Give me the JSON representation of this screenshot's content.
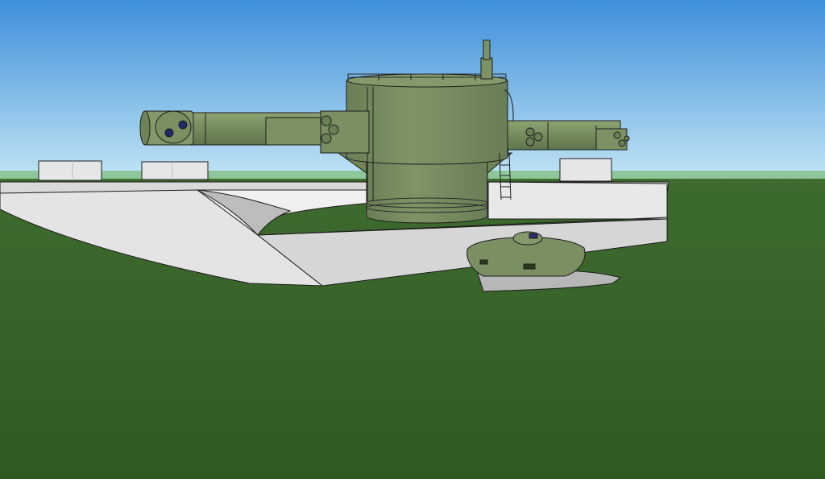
{
  "scene": {
    "kind": "3d-model-viewport",
    "colors": {
      "sky_top": "#3e8edb",
      "sky_bottom": "#bfe3f3",
      "distant_ground": "#8cc69a",
      "grass": "#3f6b2f",
      "grass_dark": "#2f5a22",
      "concrete": "#e2e2e2",
      "concrete_shadow": "#b8b8b8",
      "turret_green": "#7a8f62",
      "turret_green_dark": "#5f744d",
      "outline": "#1d1d1d"
    }
  }
}
